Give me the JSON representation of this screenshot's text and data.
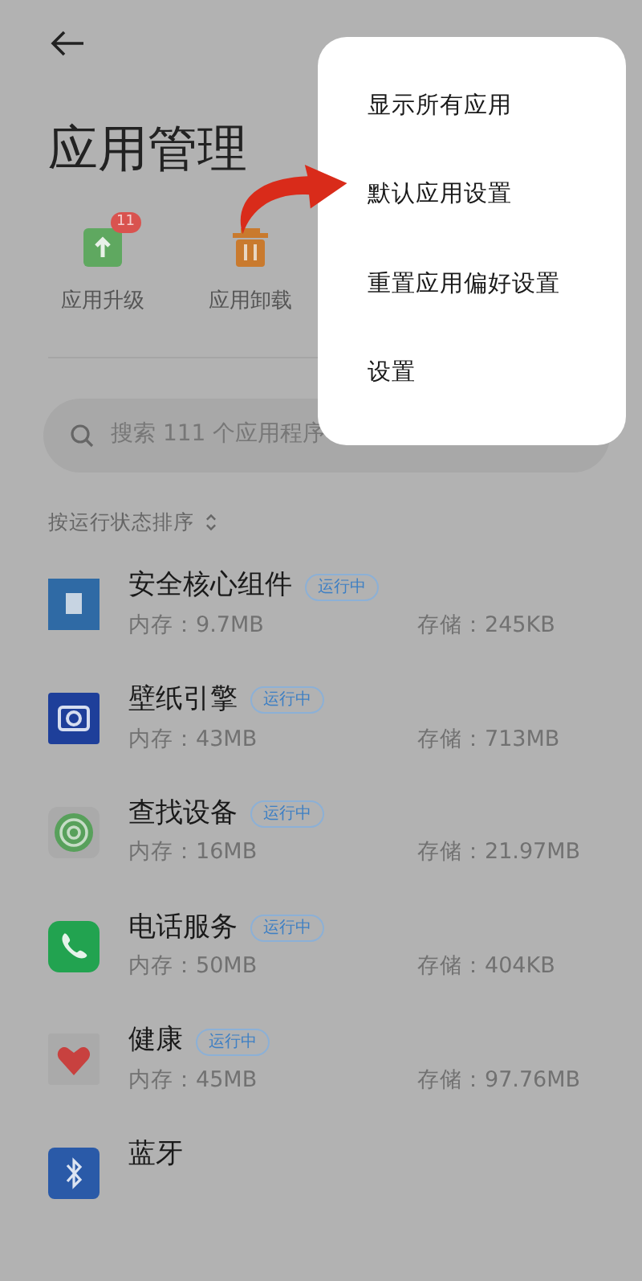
{
  "title": "应用管理",
  "quick_actions": [
    {
      "kind": "upgrade",
      "label": "应用升级",
      "badge": "11"
    },
    {
      "kind": "uninstall",
      "label": "应用卸载"
    }
  ],
  "search": {
    "placeholder": "搜索 111 个应用程序"
  },
  "sort": {
    "label": "按运行状态排序"
  },
  "apps": [
    {
      "kind": "security",
      "name": "安全核心组件",
      "status": "运行中",
      "memory": "内存：9.7MB",
      "storage": "存储：245KB"
    },
    {
      "kind": "wallpaper",
      "name": "壁纸引擎",
      "status": "运行中",
      "memory": "内存：43MB",
      "storage": "存储：713MB"
    },
    {
      "kind": "find",
      "name": "查找设备",
      "status": "运行中",
      "memory": "内存：16MB",
      "storage": "存储：21.97MB"
    },
    {
      "kind": "phone",
      "name": "电话服务",
      "status": "运行中",
      "memory": "内存：50MB",
      "storage": "存储：404KB"
    },
    {
      "kind": "health",
      "name": "健康",
      "status": "运行中",
      "memory": "内存：45MB",
      "storage": "存储：97.76MB"
    },
    {
      "kind": "bluetooth",
      "name": "蓝牙"
    }
  ],
  "menu": {
    "items": [
      {
        "label": "显示所有应用"
      },
      {
        "label": "默认应用设置"
      },
      {
        "label": "重置应用偏好设置"
      },
      {
        "label": "设置"
      }
    ]
  }
}
